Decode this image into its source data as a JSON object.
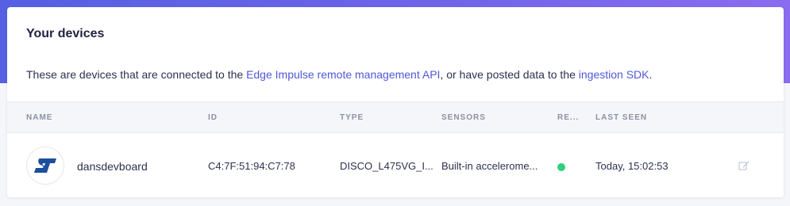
{
  "panel": {
    "title": "Your devices",
    "description_prefix": "These are devices that are connected to the ",
    "remote_api_link": "Edge Impulse remote management API",
    "description_middle": ", or have posted data to the ",
    "sdk_link": "ingestion SDK",
    "description_suffix": "."
  },
  "table": {
    "columns": [
      "NAME",
      "ID",
      "TYPE",
      "SENSORS",
      "RE...",
      "LAST SEEN"
    ],
    "rows": [
      {
        "icon": "st-logo-icon",
        "name": "dansdevboard",
        "id": "C4:7F:51:94:C7:78",
        "type": "DISCO_L475VG_I...",
        "sensors": "Built-in accelerome...",
        "remote_connected": true,
        "last_seen": "Today, 15:02:53"
      }
    ]
  },
  "colors": {
    "accent": "#4f57d8",
    "status_online": "#2fcf7c",
    "header_gradient_start": "#5560e2",
    "header_gradient_end": "#8a6cf0"
  }
}
